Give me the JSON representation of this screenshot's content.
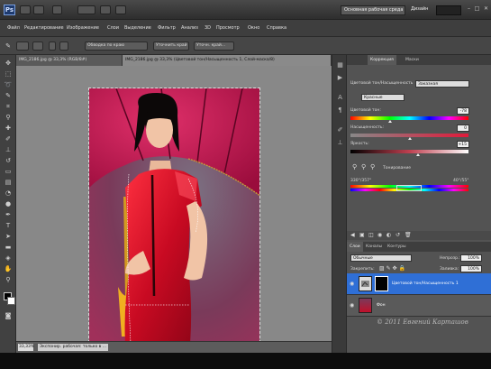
{
  "titlebar": {
    "app_logo": "Ps",
    "workspace": "Основная рабочая среда",
    "design": "Дизайн",
    "icons": [
      "minimize-icon",
      "maximize-icon",
      "close-icon"
    ]
  },
  "menu": [
    "Файл",
    "Редактирование",
    "Изображение",
    "Слои",
    "Выделение",
    "Фильтр",
    "Анализ",
    "3D",
    "Просмотр",
    "Окно",
    "Справка"
  ],
  "options": {
    "field1": "Обводка по краю",
    "field2": "Уточнить край",
    "field3": "Уточн. край..."
  },
  "document": {
    "tabs": [
      "IMG_2186.jpg @ 33,3% (RGB/8#)",
      "IMG_2186.jpg @ 33,3% (Цветовой тон/Насыщенность 1, Слой-маска/8)"
    ],
    "zoom": "33,33%",
    "status": "Экспонир. рабочая: только в ..."
  },
  "adjustments": {
    "tabs": [
      "Коррекция",
      "Маски"
    ],
    "preset": "Заказная",
    "channel": "Красные",
    "hue": {
      "label": "Цветовой тон:",
      "value": "-78"
    },
    "saturation": {
      "label": "Насыщенность:",
      "value": "0"
    },
    "lightness": {
      "label": "Яркость:",
      "value": "+15"
    },
    "colorize": "Тонирование",
    "range": {
      "left": "330°/357°",
      "right": "40°/55°"
    },
    "hue_value": -78,
    "saturation_value": 0,
    "lightness_value": 15
  },
  "layers": {
    "tabs": [
      "Слои",
      "Каналы",
      "Контуры"
    ],
    "blend_mode": "Обычные",
    "opacity_label": "Непрозр.:",
    "opacity": "100%",
    "lock_label": "Закрепить:",
    "fill_label": "Заливка:",
    "fill": "100%",
    "items": [
      {
        "name": "Цветовой тон/Насыщенность 1",
        "selected": true
      },
      {
        "name": "Фон",
        "selected": false
      }
    ]
  },
  "watermark": "© 2011 Евгений Карташов",
  "colors": {
    "dress": "#d10a2a",
    "umbrella": "#c4104a",
    "selection_blue": "#2f6fd6"
  }
}
